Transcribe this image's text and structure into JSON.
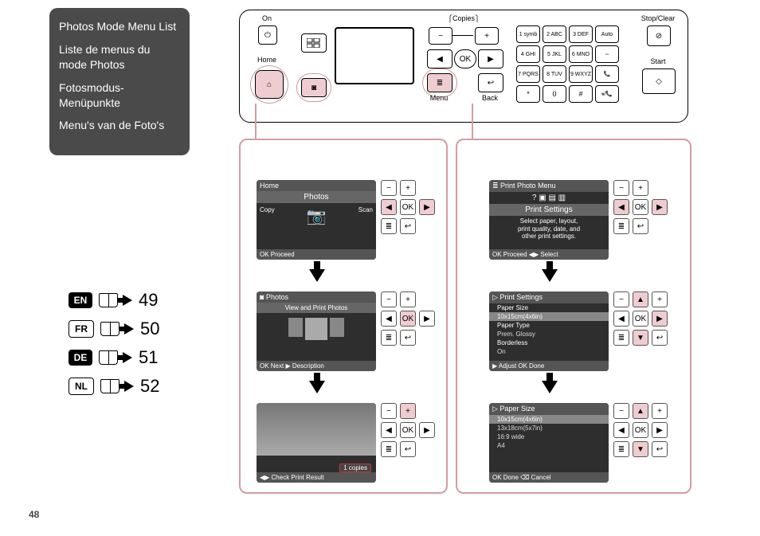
{
  "info_box": {
    "en": "Photos Mode Menu List",
    "fr": "Liste de menus du mode Photos",
    "de": "Fotosmodus-Menüpunkte",
    "nl": "Menu's van de Foto's"
  },
  "lang_pages": {
    "en": {
      "code": "EN",
      "page": "49"
    },
    "fr": {
      "code": "FR",
      "page": "50"
    },
    "de": {
      "code": "DE",
      "page": "51"
    },
    "nl": {
      "code": "NL",
      "page": "52"
    }
  },
  "page_number": "48",
  "panel": {
    "on": "On",
    "home": "Home",
    "copies": "Copies",
    "menu": "Menu",
    "back": "Back",
    "ok": "OK",
    "stop_clear": "Stop/Clear",
    "start": "Start",
    "minus": "−",
    "plus": "+",
    "dial": {
      "k1": "1 symb",
      "k2": "2 ABC",
      "k3": "3 DEF",
      "kauto": "Auto",
      "k4": "4 GHI",
      "k5": "5 JKL",
      "k6": "6 MNO",
      "kfit": "⇔",
      "k7": "7 PQRS",
      "k8": "8 TUV",
      "k9": "9 WXYZ",
      "kred": "📞",
      "kst": "*",
      "k0": "0",
      "khash": "#",
      "kpa": "⏸/📞"
    }
  },
  "callouts": {
    "photo": "◙",
    "menu": "≣"
  },
  "flow_a": {
    "s1": {
      "top": "Home",
      "mid": "Photos",
      "left": "Copy",
      "right": "Scan",
      "bot": "OK  Proceed"
    },
    "s2": {
      "top": "◙ Photos",
      "mid": "View and Print Photos",
      "bot": "OK Next  ▶ Description"
    },
    "s3": {
      "topcenter": "",
      "label": "1 copies",
      "bot": "◀▶ Check Print Result"
    }
  },
  "flow_b": {
    "s1": {
      "top": "≣ Print Photo Menu",
      "mid": "Print Settings",
      "body1": "Select paper, layout,",
      "body2": "print quality, date, and",
      "body3": "other print settings.",
      "bot": "OK Proceed  ◀▶ Select"
    },
    "s2": {
      "top": "▷ Print Settings",
      "row1": "Paper Size",
      "row1v": "10x15cm(4x6in)",
      "row2": "Paper Type",
      "row2v": "Prem. Glossy",
      "row3": "Borderless",
      "row3v": "On",
      "bot": "▶ Adjust  OK Done"
    },
    "s3": {
      "top": "▷ Paper Size",
      "o1": "10x15cm(4x6in)",
      "o2": "13x18cm(5x7in)",
      "o3": "16:9 wide",
      "o4": "A4",
      "bot": "OK Done  ⌫ Cancel"
    }
  }
}
